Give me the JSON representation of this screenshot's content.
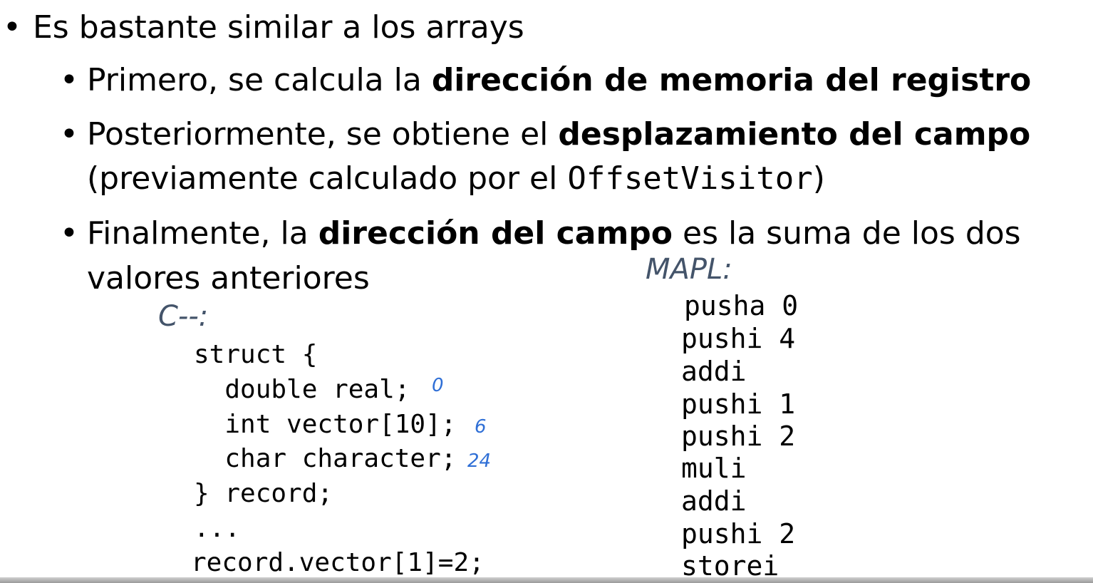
{
  "bullets": {
    "b1": {
      "text": "Es bastante similar a los arrays"
    },
    "b2": {
      "pre": "Primero, se calcula la ",
      "bold": "dirección de memoria del registro"
    },
    "b3": {
      "pre": "Posteriormente, se obtiene el ",
      "bold": "desplazamiento del campo",
      "line2_pre": "(previamente calculado por el ",
      "mono": "OffsetVisitor",
      "line2_post": ")"
    },
    "b4": {
      "pre": "Finalmente, la ",
      "bold": "dirección del campo",
      "post": " es la suma de los dos",
      "line2": "valores anteriores"
    }
  },
  "cmm": {
    "label": "C--:",
    "lines": [
      "struct {",
      "  double real;",
      "  int vector[10];",
      "  char character;",
      "} record;",
      "...",
      "record.vector[1]=2;"
    ],
    "annotations": [
      "0",
      "6",
      "24"
    ]
  },
  "mapl": {
    "label": "MAPL:",
    "lines": [
      "pusha 0",
      "pushi 4",
      "addi",
      "pushi 1",
      "pushi 2",
      "muli",
      "addi",
      "pushi 2",
      "storei"
    ]
  }
}
